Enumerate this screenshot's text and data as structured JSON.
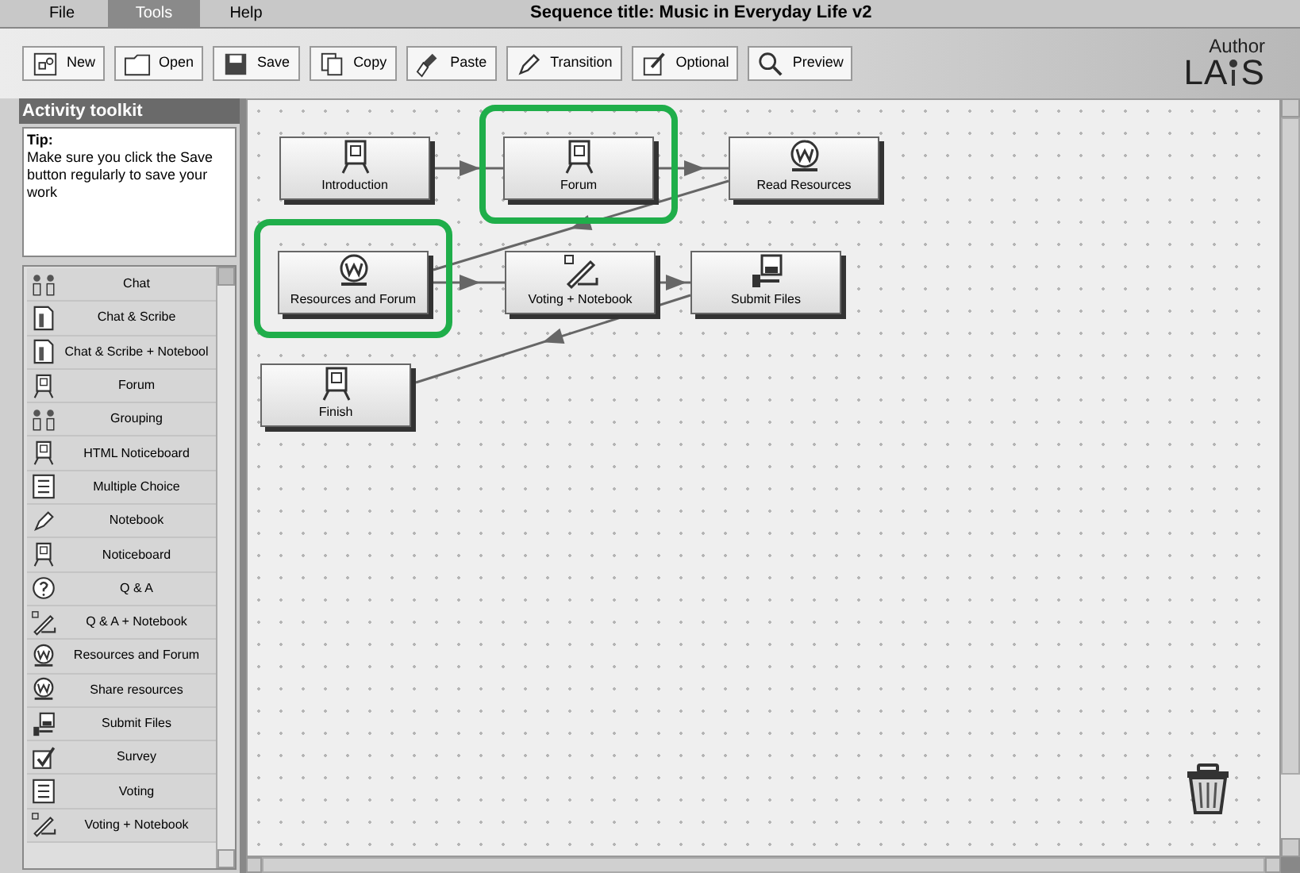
{
  "menu": [
    {
      "label": "File",
      "selected": false
    },
    {
      "label": "Tools",
      "selected": true
    },
    {
      "label": "Help",
      "selected": false
    }
  ],
  "sequence_title": "Sequence title: Music in Everyday Life v2",
  "toolbar": [
    {
      "label": "New"
    },
    {
      "label": "Open"
    },
    {
      "label": "Save"
    },
    {
      "label": "Copy"
    },
    {
      "label": "Paste"
    },
    {
      "label": "Transition"
    },
    {
      "label": "Optional"
    },
    {
      "label": "Preview"
    }
  ],
  "branding": {
    "role": "Author",
    "logo_left": "LA",
    "logo_right": "S"
  },
  "toolkit": {
    "title": "Activity toolkit",
    "tip_title": "Tip:",
    "tip": "Make sure you click the Save button regularly to save your work",
    "items": [
      {
        "label": "Chat"
      },
      {
        "label": "Chat & Scribe"
      },
      {
        "label": "Chat & Scribe + Notebool"
      },
      {
        "label": "Forum"
      },
      {
        "label": "Grouping"
      },
      {
        "label": "HTML Noticeboard"
      },
      {
        "label": "Multiple Choice"
      },
      {
        "label": "Notebook"
      },
      {
        "label": "Noticeboard"
      },
      {
        "label": "Q & A"
      },
      {
        "label": "Q & A + Notebook"
      },
      {
        "label": "Resources and Forum"
      },
      {
        "label": "Share resources"
      },
      {
        "label": "Submit Files"
      },
      {
        "label": "Survey"
      },
      {
        "label": "Voting"
      },
      {
        "label": "Voting + Notebook"
      }
    ]
  },
  "canvas": {
    "activities": [
      {
        "label": "Introduction",
        "highlighted": false
      },
      {
        "label": "Forum",
        "highlighted": true
      },
      {
        "label": "Read Resources",
        "highlighted": false
      },
      {
        "label": "Resources and Forum",
        "highlighted": true
      },
      {
        "label": "Voting + Notebook",
        "highlighted": false
      },
      {
        "label": "Submit Files",
        "highlighted": false
      },
      {
        "label": "Finish",
        "highlighted": false
      }
    ]
  }
}
